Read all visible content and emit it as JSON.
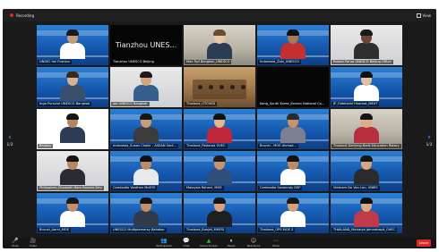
{
  "window": {
    "recording_label": "Recording",
    "view_label": "View"
  },
  "nav": {
    "left_page": "1/2",
    "right_page": "1/2"
  },
  "participants": [
    {
      "name": "UNSEC Imi Fushion",
      "bg": "banner",
      "skin": "#c69a7c",
      "hair": "#1b1b1b",
      "shirt": "#ffffff"
    },
    {
      "name": "Tianzhou UNESCO Beijing",
      "bg": "black",
      "display": "Tianzhou  UNES..."
    },
    {
      "name": "Max Fyd Bangkok_UNESCO",
      "bg": "office",
      "skin": "#e8c6a8",
      "hair": "#6a4c30",
      "shirt": "#2b3d55",
      "active": true
    },
    {
      "name": "Indonesia_Zaki_UNESCO",
      "bg": "banner",
      "skin": "#a97b55",
      "hair": "#111111",
      "shirt": "#c42f2f"
    },
    {
      "name": "Robert Parua UNESCO Beijing Office",
      "bg": "wall",
      "skin": "#6b4632",
      "hair": "#1a1a1a",
      "shirt": "#2e2e2e"
    },
    {
      "name": "Ingo Pursche UNESCO Bangkok",
      "bg": "banner",
      "skin": "#d9b493",
      "hair": "#3b2a1c",
      "shirt": "#3a4f6b"
    },
    {
      "name": "Job UNESCO Bangkok",
      "bg": "wall",
      "skin": "#d6a679",
      "hair": "#1b1b1b",
      "shirt": "#355f8f"
    },
    {
      "name": "Thailand_OTCHED",
      "bg": "room",
      "conference": true
    },
    {
      "name": "Kang_South Korea_Korean National Co...",
      "bg": "black"
    },
    {
      "name": "JP_Hidetoshi Hiramat_MEXT",
      "bg": "banner",
      "skin": "#e2c0a2",
      "hair": "#111111",
      "shirt": "#ffffff"
    },
    {
      "name": "Bhutan",
      "bg": "white",
      "skin": "#b98561",
      "hair": "#151515",
      "shirt": "#2d3b57"
    },
    {
      "name": "Indonesia_Susan Chakir - ASEAN Sect...",
      "bg": "banner",
      "skin": "#c99b79",
      "hair": "#161616",
      "shirt": "#3b3b3b"
    },
    {
      "name": "Thailand_Pattaraa OVEC",
      "bg": "banner",
      "skin": "#e0b692",
      "hair": "#111111",
      "shirt": "#c0273a"
    },
    {
      "name": "Brunei - MOE Ahmad...",
      "bg": "banner",
      "skin": "#c8936a",
      "hair": "#2a2a2a",
      "shirt": "#7f7f8f"
    },
    {
      "name": "Thailand Darlying Beds Education Rotary",
      "bg": "office",
      "skin": "#dcae8a",
      "hair": "#141414",
      "shirt": "#b72f3f"
    },
    {
      "name": "Philippines_Elizabeth Ram Rosario Dev",
      "bg": "wall",
      "skin": "#b88660",
      "hair": "#141414",
      "shirt": "#2b2b33"
    },
    {
      "name": "Cambodia Vanthen MoEYS",
      "bg": "banner",
      "skin": "#bd8c66",
      "hair": "#111111",
      "shirt": "#e9e9e9"
    },
    {
      "name": "Malaysia Rohani, MOE",
      "bg": "banner",
      "skin": "#c79570",
      "hair": "#1d1d1d",
      "shirt": "#2f4f7c"
    },
    {
      "name": "Cambodia Sovanndy DSP",
      "bg": "banner",
      "skin": "#c08b62",
      "hair": "#111111",
      "shirt": "#ffffff"
    },
    {
      "name": "Vietnam Do Van Lan, VNIES",
      "bg": "banner",
      "skin": "#d5a67f",
      "hair": "#151515",
      "shirt": "#2b2b2b"
    },
    {
      "name": "Brunei_Aarni_MOE",
      "bg": "banner",
      "skin": "#c68f67",
      "hair": "#1a1a1a",
      "shirt": "#ffffff"
    },
    {
      "name": "UNESCO Multiplemarsy Bahakor",
      "bg": "banner",
      "skin": "#c38f68",
      "hair": "#141414",
      "shirt": "#303a4a"
    },
    {
      "name": "Thailand_Bunjet_MHESI",
      "bg": "banner",
      "skin": "#d7a37d",
      "hair": "#151515",
      "shirt": "#1e1e1e"
    },
    {
      "name": "Thailand_OPS MOE 2",
      "bg": "banner",
      "skin": "#d6a27b",
      "hair": "#1a1a1a",
      "shirt": "#ffffff"
    },
    {
      "name": "THAILAND_Nichaiya Jamnahapit_OVEC",
      "bg": "banner",
      "skin": "#dcaa84",
      "hair": "#111111",
      "shirt": "#c13a4a"
    }
  ],
  "toolbar": {
    "left": [
      {
        "icon": "🎤",
        "label": "Mute"
      },
      {
        "icon": "🎥",
        "label": "Video"
      }
    ],
    "mid": [
      {
        "icon": "👥",
        "label": "Participants"
      },
      {
        "icon": "💬",
        "label": "Chat"
      },
      {
        "icon": "▲",
        "label": "Share Screen"
      },
      {
        "icon": "⏸",
        "label": "Pause"
      },
      {
        "icon": "☺",
        "label": "Reactions"
      },
      {
        "icon": "⋯",
        "label": "More"
      }
    ],
    "leave_label": "Leave"
  }
}
